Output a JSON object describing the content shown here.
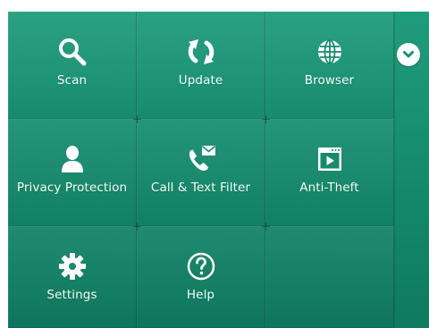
{
  "menu": {
    "tiles": [
      {
        "label": "Scan",
        "icon": "search-icon"
      },
      {
        "label": "Update",
        "icon": "refresh-icon"
      },
      {
        "label": "Browser",
        "icon": "globe-icon"
      },
      {
        "label": "Privacy Protection",
        "icon": "person-icon"
      },
      {
        "label": "Call & Text Filter",
        "icon": "phone-message-icon"
      },
      {
        "label": "Anti-Theft",
        "icon": "window-play-icon"
      },
      {
        "label": "Settings",
        "icon": "gear-icon"
      },
      {
        "label": "Help",
        "icon": "help-icon"
      }
    ],
    "expand_icon": "chevron-down-icon"
  },
  "colors": {
    "tile_bg": "#1a9174",
    "icon": "#ffffff",
    "chevron": "#159073"
  }
}
